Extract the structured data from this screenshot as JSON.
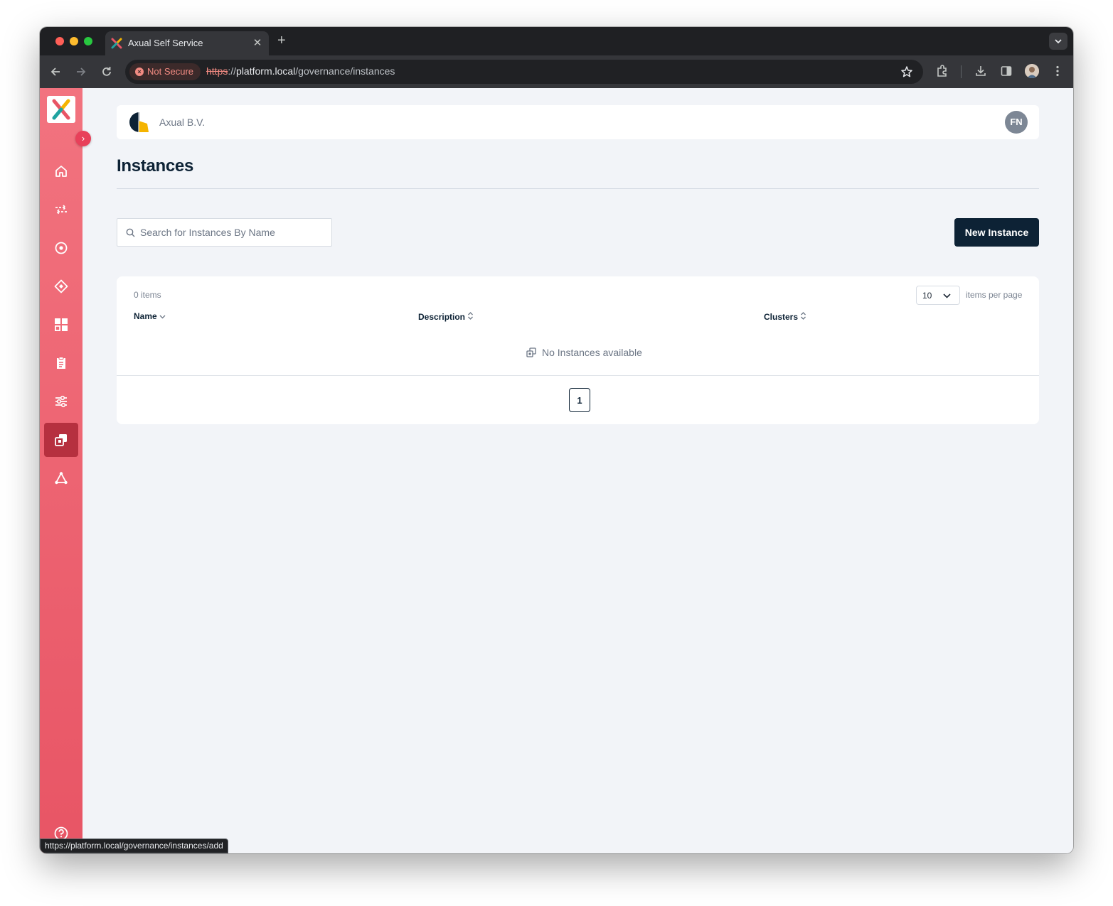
{
  "browser": {
    "tab_title": "Axual Self Service",
    "tab_close": "✕",
    "new_tab": "+",
    "security_label": "Not Secure",
    "url_scheme": "https",
    "url_sep": "://",
    "url_host": "platform.local",
    "url_path": "/governance/instances",
    "status_url": "https://platform.local/governance/instances/add"
  },
  "sidebar": {
    "collapse_glyph": "›",
    "items": [
      {
        "icon": "home-icon",
        "active": false
      },
      {
        "icon": "streams-icon",
        "active": false
      },
      {
        "icon": "applications-icon",
        "active": false
      },
      {
        "icon": "connectors-icon",
        "active": false
      },
      {
        "icon": "dashboard-icon",
        "active": false
      },
      {
        "icon": "clipboard-icon",
        "active": false
      },
      {
        "icon": "settings-sliders-icon",
        "active": false
      },
      {
        "icon": "instances-icon",
        "active": true
      },
      {
        "icon": "network-icon",
        "active": false
      }
    ],
    "help_icon": "help-icon"
  },
  "header": {
    "org_name": "Axual B.V.",
    "avatar_initials": "FN"
  },
  "page": {
    "title": "Instances",
    "search_placeholder": "Search for Instances By Name",
    "new_button": "New Instance"
  },
  "table": {
    "count_label": "0 items",
    "per_page_value": "10",
    "per_page_label": "items per page",
    "columns": [
      "Name",
      "Description",
      "Clusters"
    ],
    "empty_message": "No Instances available",
    "current_page": "1"
  },
  "colors": {
    "sidebar_top": "#f2737f",
    "sidebar_bottom": "#e85565",
    "sidebar_active": "#b6303f",
    "primary_dark": "#0d2235",
    "page_bg": "#f2f4f8"
  }
}
